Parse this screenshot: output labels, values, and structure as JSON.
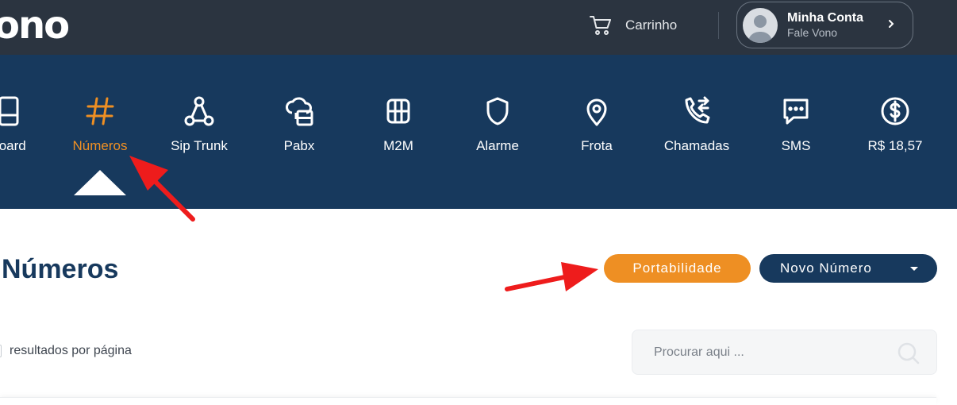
{
  "header": {
    "logo_text": "ono",
    "cart_label": "Carrinho",
    "account_name": "Minha Conta",
    "account_sub": "Fale Vono"
  },
  "nav": {
    "items": [
      {
        "label": "board",
        "icon": "dashboard-icon",
        "active": false
      },
      {
        "label": "Números",
        "icon": "hash-icon",
        "active": true
      },
      {
        "label": "Sip Trunk",
        "icon": "sip-trunk-icon",
        "active": false
      },
      {
        "label": "Pabx",
        "icon": "pabx-icon",
        "active": false
      },
      {
        "label": "M2M",
        "icon": "chip-icon",
        "active": false
      },
      {
        "label": "Alarme",
        "icon": "shield-icon",
        "active": false
      },
      {
        "label": "Frota",
        "icon": "location-pin-icon",
        "active": false
      },
      {
        "label": "Chamadas",
        "icon": "phone-calls-icon",
        "active": false
      },
      {
        "label": "SMS",
        "icon": "chat-bubble-icon",
        "active": false
      },
      {
        "label": "R$ 18,57",
        "icon": "dollar-coin-icon",
        "active": false
      }
    ]
  },
  "main": {
    "title": "Números",
    "portability_button": "Portabilidade",
    "new_number_button": "Novo Número",
    "per_page_label": "resultados por página",
    "search_placeholder": "Procurar aqui ..."
  },
  "colors": {
    "topbar": "#2b3440",
    "navbar": "#17395d",
    "accent": "#ee8f23",
    "annotation_arrow": "#ee1c1c"
  }
}
